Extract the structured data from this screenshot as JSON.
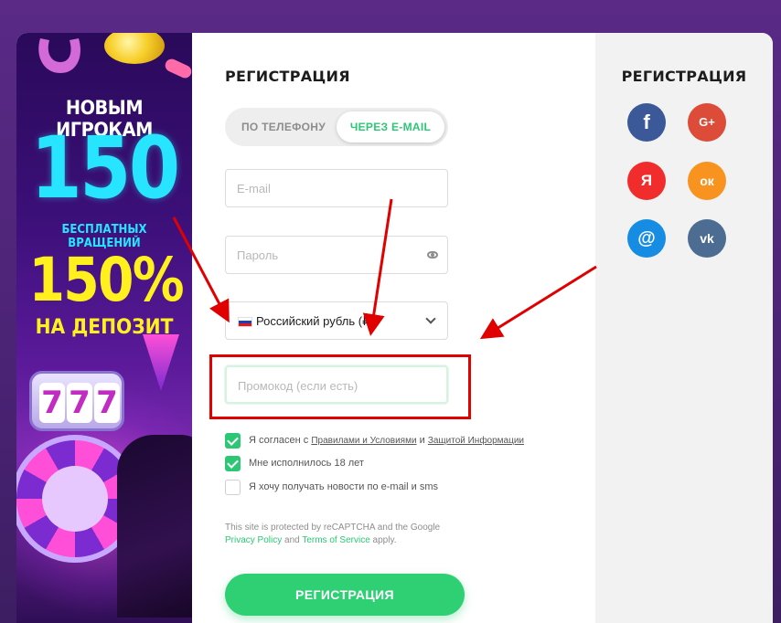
{
  "promo": {
    "line1": "НОВЫМ ИГРОКАМ",
    "big_number": "150",
    "line2": "БЕСПЛАТНЫХ ВРАЩЕНИЙ",
    "percent": "150%",
    "line3": "НА ДЕПОЗИТ",
    "slot_digits": [
      "7",
      "7",
      "7"
    ]
  },
  "form": {
    "title": "РЕГИСТРАЦИЯ",
    "tabs": [
      {
        "label": "ПО ТЕЛЕФОНУ",
        "active": false
      },
      {
        "label": "ЧЕРЕЗ E-MAIL",
        "active": true
      }
    ],
    "email_placeholder": "E-mail",
    "password_placeholder": "Пароль",
    "currency_value": "Российский рубль (₽",
    "promo_placeholder": "Промокод (если есть)",
    "checks": [
      {
        "checked": true,
        "text_before": "Я согласен с ",
        "link1": "Правилами и Условиями",
        "middle": " и ",
        "link2": "Защитой Информации"
      },
      {
        "checked": true,
        "text": "Мне исполнилось 18 лет"
      },
      {
        "checked": false,
        "text": "Я хочу получать новости по e-mail и sms"
      }
    ],
    "recaptcha": {
      "text1": "This site is protected by reCAPTCHA and the Google",
      "privacy": "Privacy Policy",
      "and": " and ",
      "terms": "Terms of Service",
      "applies": " apply."
    },
    "submit_label": "РЕГИСТРАЦИЯ"
  },
  "social": {
    "title": "РЕГИСТРАЦИЯ",
    "buttons": [
      {
        "icon": "facebook-icon",
        "glyph": "f",
        "color": "#3b5998"
      },
      {
        "icon": "google-plus-icon",
        "glyph": "G+",
        "color": "#dd4b39"
      },
      {
        "icon": "yandex-icon",
        "glyph": "Я",
        "color": "#f02c2c"
      },
      {
        "icon": "odnoklassniki-icon",
        "glyph": "ок",
        "color": "#f7931e"
      },
      {
        "icon": "mailru-icon",
        "glyph": "@",
        "color": "#168de2"
      },
      {
        "icon": "vk-icon",
        "glyph": "vk",
        "color": "#4c6c91"
      }
    ]
  },
  "colors": {
    "accent": "#2cc774",
    "annotation": "#e00000",
    "background": "#4a2374"
  }
}
